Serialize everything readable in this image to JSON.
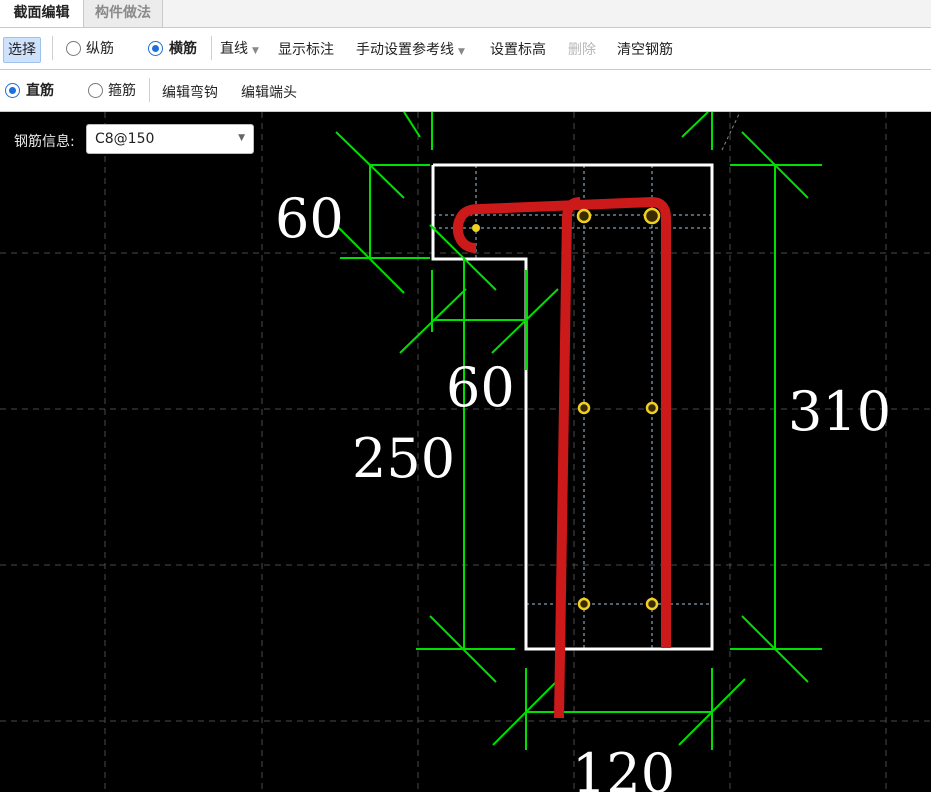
{
  "tabs": [
    {
      "label": "截面编辑",
      "active": true
    },
    {
      "label": "构件做法",
      "active": false
    }
  ],
  "toolbar1": {
    "select": "选择",
    "longitudinal": "纵筋",
    "transverse": "横筋",
    "line_mode": "直线",
    "show_labels": "显示标注",
    "manual_ref": "手动设置参考线",
    "set_elevation": "设置标高",
    "delete": "删除",
    "clear_rebar": "清空钢筋"
  },
  "toolbar2": {
    "straight": "直筋",
    "stirrup": "箍筋",
    "edit_hook": "编辑弯钩",
    "edit_end": "编辑端头"
  },
  "rebar_info": {
    "label": "钢筋信息:",
    "value": "C8@150"
  },
  "dimensions": {
    "top_left_width": "60",
    "step_height": "60",
    "lower_height": "250",
    "total_height": "310",
    "bottom_width": "120"
  },
  "colors": {
    "dimension": "#00e000",
    "rebar": "#cc1a1a",
    "outline": "#ffffff",
    "node": "#f0d020",
    "accent": "#1e6fd9"
  }
}
